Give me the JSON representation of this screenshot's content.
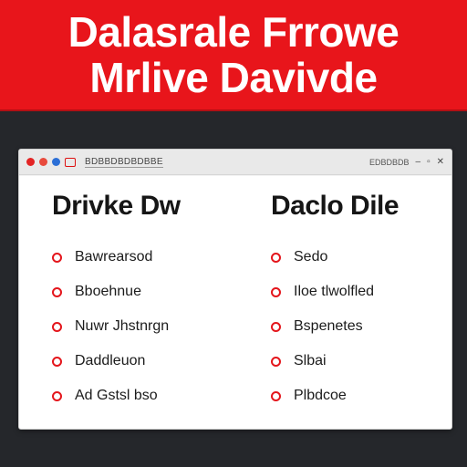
{
  "banner": {
    "line1": "Dalasrale Frrowe",
    "line2": "Mrlive Davivde"
  },
  "window": {
    "title": "BDBBDBDBDBBE",
    "right_label": "EDBDBDB",
    "buttons": {
      "minimize": "–",
      "maximize": "▫",
      "close": "✕"
    }
  },
  "left_column": {
    "heading": "Drivke Dw",
    "items": [
      "Bawrearsod",
      "Bboehnue",
      "Nuwr Jhstnrgn",
      "Daddleuon",
      "Ad Gstsl bso"
    ]
  },
  "right_column": {
    "heading": "Daclo Dile",
    "items": [
      "Sedo",
      "Iloe tlwolfled",
      "Bspenetes",
      "Slbai",
      "Plbdcoe"
    ]
  },
  "colors": {
    "accent": "#e8151b",
    "background": "#25272b",
    "bullet": "#e4161c"
  }
}
